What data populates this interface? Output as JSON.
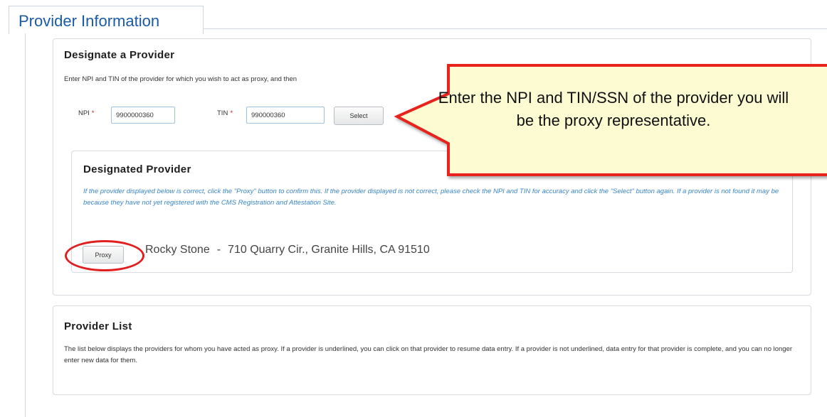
{
  "header": {
    "title": "Provider Information"
  },
  "designate": {
    "heading": "Designate a Provider",
    "instructions": "Enter NPI and TIN of the provider for which you wish to act as proxy, and then",
    "npi_label": "NPI",
    "npi_value": "9900000360",
    "tin_label": "TIN",
    "tin_value": "990000360",
    "required_mark": "*",
    "select_label": "Select"
  },
  "designated_provider": {
    "heading": "Designated Provider",
    "help_text": "If the provider displayed below is correct, click the \"Proxy\" button to confirm this.  If the provider displayed is not correct, please check the NPI and TIN for accuracy and click the \"Select\" button again.  If a provider is not found it may be because they have not yet registered with the CMS Registration and Attestation Site.",
    "proxy_label": "Proxy",
    "provider_name": "Rocky Stone",
    "separator": "-",
    "provider_address": "710 Quarry Cir., Granite Hills, CA 91510"
  },
  "provider_list": {
    "heading": "Provider List",
    "description": "The list below displays the providers for whom you have acted as proxy.  If a provider is underlined, you can click on that provider to resume data entry.  If a provider is not underlined, data entry for that provider is complete, and you can no longer enter new data for them."
  },
  "callout": {
    "text": "Enter the NPI and TIN/SSN of the provider you will be the proxy representative.",
    "fill_color": "#fdfbd2",
    "border_color": "#e8231f"
  },
  "colors": {
    "header_blue": "#1a5aa6",
    "help_text_blue": "#3b86c9",
    "required_red": "#d02020",
    "annotation_red": "#e02020"
  }
}
